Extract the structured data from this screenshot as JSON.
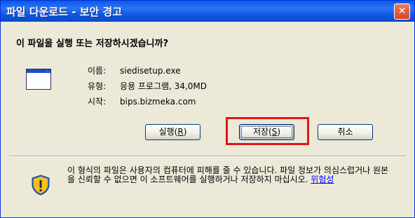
{
  "window": {
    "title": "파일 다운로드 - 보안 경고",
    "close_glyph": "✕"
  },
  "question": "이 파일을 실행 또는 저장하시겠습니까?",
  "file": {
    "icon": "application-window-icon",
    "name_label": "이름:",
    "name_value": "siedisetup.exe",
    "type_label": "유형:",
    "type_value": "응용 프로그램, 34,0MD",
    "from_label": "시작:",
    "from_value": "bips.bizmeka.com"
  },
  "buttons": {
    "run_text": "실행(",
    "run_key": "R",
    "run_end": ")",
    "save_text": "저장(",
    "save_key": "S",
    "save_end": ")",
    "cancel": "취소"
  },
  "warning": {
    "text": "이 형식의 파일은 사용자의 컴퓨터에 피해를 줄 수 있습니다. 파일 정보가 의심스럽거나 원본을 신뢰할 수 없으면 이 소프트웨어를 실행하거나 저장하지 마십시오. ",
    "link": "위험성",
    "icon": "shield-warning-icon"
  },
  "colors": {
    "titlebar": "#0a5ae8",
    "highlight": "#e01616",
    "link": "#0000ff"
  }
}
